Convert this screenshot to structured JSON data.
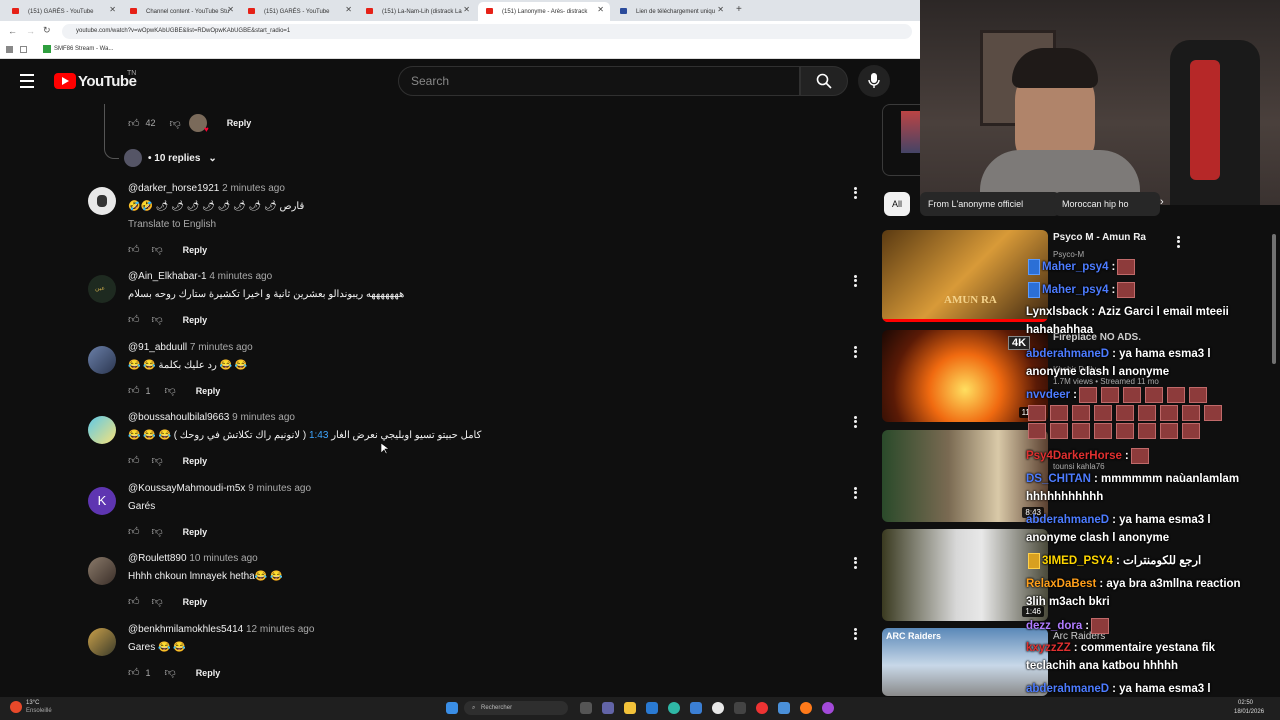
{
  "browser": {
    "tabs": [
      {
        "label": "(151) GARÉS - YouTube"
      },
      {
        "label": "Channel content - YouTube Stu"
      },
      {
        "label": "(151) GARÉS - YouTube"
      },
      {
        "label": "(151) La-Nam-Lih (distrack La"
      },
      {
        "label": "(151) Lanonyme - Arès- distrack"
      },
      {
        "label": "Lien de téléchargement uniqu"
      }
    ],
    "url": "youtube.com/watch?v=wOpwKAbUGBE&list=RDwOpwKAbUGBE&start_radio=1",
    "bookmark": "SMF86 Stream - Wa..."
  },
  "header": {
    "logo_text": "YouTube",
    "country_code": "TN",
    "search_placeholder": "Search"
  },
  "thread": {
    "likes": "42",
    "reply_label": "Reply",
    "replies_label": "• 10 replies"
  },
  "comments": [
    {
      "user": "@darker_horse1921",
      "time": "2 minutes ago",
      "text": "🤣🤣 🌶 🌶 🌶 🌶 🌶 🌶 🌶 🌶 قارص",
      "translate": "Translate to English",
      "likes": "",
      "reply": "Reply"
    },
    {
      "user": "@Ain_Elkhabar-1",
      "time": "4 minutes ago",
      "text": "هههههههه ريبوندالو بعشرين ثانية و اخيرا تكشيرة ستارك روحه بسلام",
      "likes": "",
      "reply": "Reply"
    },
    {
      "user": "@91_abduull",
      "time": "7 minutes ago",
      "text": "😂 😂 رد عليك بكلمة 😂 😂",
      "likes": "1",
      "reply": "Reply"
    },
    {
      "user": "@boussahoulbilal9663",
      "time": "9 minutes ago",
      "text": "😂 😂 😂 ( لانونيم راك تكلاتش في روحك ) كامل حبيتو تسيو اوبليجي نعرض الغار",
      "timestamp_link": "1:43",
      "likes": "",
      "reply": "Reply"
    },
    {
      "user": "@KoussayMahmoudi-m5x",
      "time": "9 minutes ago",
      "text": "Garés",
      "likes": "",
      "reply": "Reply",
      "avatar_letter": "K"
    },
    {
      "user": "@Roulett890",
      "time": "10 minutes ago",
      "text": "Hhhh chkoun lmnayek hetha😂 😂",
      "likes": "",
      "reply": "Reply"
    },
    {
      "user": "@benkhmilamokhles5414",
      "time": "12 minutes ago",
      "text": "Gares 😂 😂",
      "likes": "1",
      "reply": "Reply"
    }
  ],
  "sidebar": {
    "chips": [
      "All",
      "From L'anonyme officiel",
      "Moroccan hip ho"
    ],
    "videos": [
      {
        "title": "Psyco M - Amun Ra",
        "channel": "Psyco-M",
        "thumb_text": "AMUN RA"
      },
      {
        "title": "Fireplace NO ADS.",
        "channel": "Khabir Daily",
        "meta": "1.7M views • Streamed 11 mo",
        "duration": "11:54",
        "badge": "4K"
      },
      {
        "title": "",
        "channel": "tounsi kahla76",
        "duration": "8:43"
      },
      {
        "title": "",
        "channel": "",
        "duration": "1:46"
      },
      {
        "title": "Arc Raiders",
        "channel": "",
        "thumb_text": "ARC Raiders"
      }
    ]
  },
  "chat": [
    {
      "user": "Maher_psy4",
      "color": "#4d7cff",
      "text": ":"
    },
    {
      "user": "Maher_psy4",
      "color": "#4d7cff",
      "text": ":"
    },
    {
      "user": "Lynxlsback",
      "color": "#ffffff",
      "text": ": Aziz Garci l email mteeii hahahahhaa"
    },
    {
      "user": "abderahmaneD",
      "color": "#4d7cff",
      "text": ": ya hama esma3 l anonyme clash l anonyme"
    },
    {
      "user": "nvvdeer",
      "color": "#4d7cff",
      "text": ":"
    },
    {
      "user": "Psy4DarkerHorse",
      "color": "#e03030",
      "text": ":"
    },
    {
      "user": "DS_CHITAN",
      "color": "#4d7cff",
      "text": ": mmmmmm naùanlamlam hhhhhhhhhhh"
    },
    {
      "user": "abderahmaneD",
      "color": "#4d7cff",
      "text": ": ya hama esma3 l anonyme clash l anonyme"
    },
    {
      "user": "3IMED_PSY4",
      "color": "#ffd700",
      "text": ": ارجع للكومنترات"
    },
    {
      "user": "RelaxDaBest",
      "color": "#ff9f1a",
      "text": ": aya bra a3mllna reaction 3lih m3ach bkri"
    },
    {
      "user": "dezz_dora",
      "color": "#b07cff",
      "text": ":"
    },
    {
      "user": "kxyzzZZ",
      "color": "#e03030",
      "text": ": commentaire yestana fik teclachih ana katbou hhhhh"
    },
    {
      "user": "abderahmaneD",
      "color": "#4d7cff",
      "text": ": ya hama esma3 l anonyme clash l anonyme"
    }
  ],
  "taskbar": {
    "weather": "13°C",
    "weather_sub": "Ensoleillé",
    "search": "Rechercher",
    "time": "02:50",
    "date": "18/01/2026"
  }
}
